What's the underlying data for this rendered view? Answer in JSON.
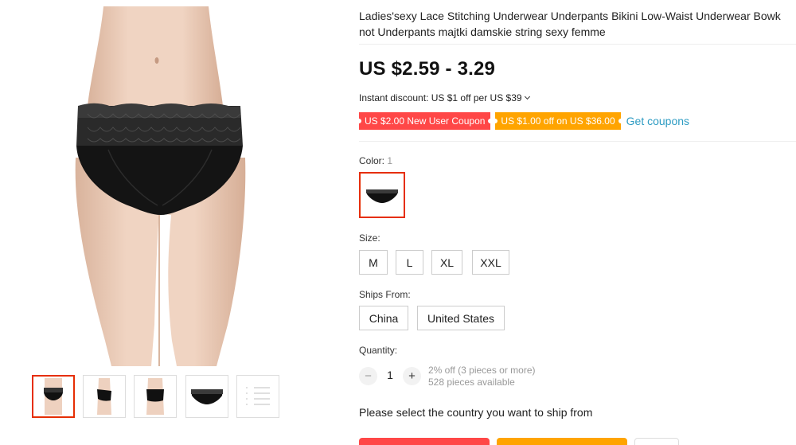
{
  "product": {
    "title_line1": "Ladies'sexy Lace Stitching Underwear Underpants Bikini Low-Waist Underwear Bowk",
    "title_line2": "not Underpants majtki damskie string sexy femme",
    "price": "US $2.59 - 3.29",
    "instant_discount": "Instant discount: US $1 off per US $39"
  },
  "coupons": {
    "new_user": "US $2.00 New User Coupon",
    "store": "US $1.00 off on US $36.00",
    "get_coupons_label": "Get coupons"
  },
  "color": {
    "label": "Color:",
    "count": "1"
  },
  "size": {
    "label": "Size:",
    "options": [
      "M",
      "L",
      "XL",
      "XXL"
    ]
  },
  "ships_from": {
    "label": "Ships From:",
    "options": [
      "China",
      "United States"
    ]
  },
  "quantity": {
    "label": "Quantity:",
    "minus": "−",
    "value": "1",
    "plus": "+",
    "discount_note": "2% off (3 pieces or more)",
    "available": "528 pieces available"
  },
  "ship_message": "Please select the country you want to ship from",
  "icons": {
    "chevron": "chevron-down-icon",
    "thumb_more": "list-icon"
  },
  "colors": {
    "accent": "#e62e04",
    "coupon_red": "#ff4747",
    "coupon_orange": "#ffa400",
    "link": "#2e9cc3"
  }
}
